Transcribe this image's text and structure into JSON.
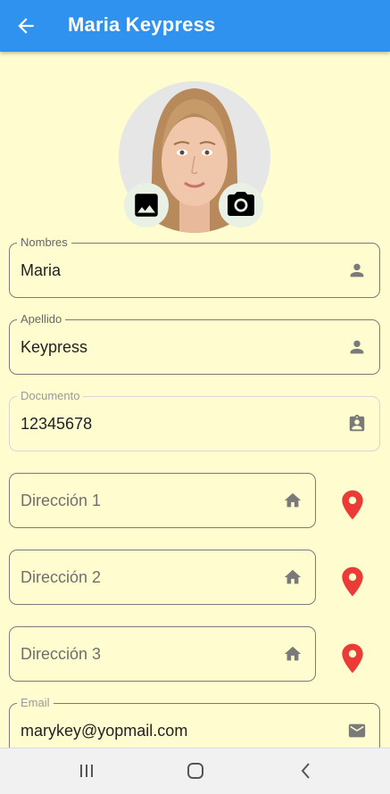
{
  "appbar": {
    "title": "Maria Keypress",
    "back_icon": "arrow-back-icon"
  },
  "avatar": {
    "alt": "profile photo",
    "gallery_icon": "image-icon",
    "camera_icon": "camera-icon"
  },
  "fields": {
    "nombres": {
      "label": "Nombres",
      "value": "Maria",
      "icon": "person-icon"
    },
    "apellido": {
      "label": "Apellido",
      "value": "Keypress",
      "icon": "person-icon"
    },
    "documento": {
      "label": "Documento",
      "value": "12345678",
      "icon": "badge-icon"
    },
    "direccion1": {
      "placeholder": "Dirección 1",
      "icon": "home-icon"
    },
    "direccion2": {
      "placeholder": "Dirección 2",
      "icon": "home-icon"
    },
    "direccion3": {
      "placeholder": "Dirección 3",
      "icon": "home-icon"
    },
    "email": {
      "label": "Email",
      "value": "marykey@yopmail.com",
      "icon": "mail-icon"
    }
  },
  "colors": {
    "appbar": "#2f92ee",
    "background": "#fffdcf",
    "pin": "#ec3b36"
  },
  "navbar": {
    "recents_icon": "recents-icon",
    "home_icon": "home-nav-icon",
    "back_icon": "back-nav-icon"
  }
}
